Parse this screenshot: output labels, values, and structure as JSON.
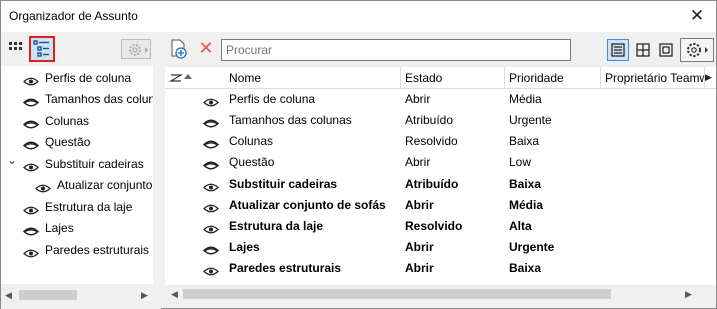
{
  "window": {
    "title": "Organizador de Assunto",
    "close_label": "✕"
  },
  "left_toolbar": {
    "grid_icon": "grid-view-icon",
    "list_icon": "hierarchy-list-icon",
    "settings_icon": "gear-icon"
  },
  "tree": [
    {
      "label": "Perfis de coluna",
      "eye": "open"
    },
    {
      "label": "Tamanhos das coluna",
      "eye": "closed"
    },
    {
      "label": "Colunas",
      "eye": "closed"
    },
    {
      "label": "Questão",
      "eye": "closed"
    },
    {
      "label": "Substituir cadeiras",
      "eye": "open",
      "expanded": true
    },
    {
      "label": "Atualizar conjunto",
      "eye": "open",
      "child": true
    },
    {
      "label": "Estrutura da laje",
      "eye": "open"
    },
    {
      "label": "Lajes",
      "eye": "closed"
    },
    {
      "label": "Paredes estruturais",
      "eye": "open"
    }
  ],
  "right_toolbar": {
    "add_icon": "add-issue-icon",
    "delete_icon": "delete-icon",
    "search_placeholder": "Procurar",
    "view_icons": [
      "list-view-icon",
      "grid-view-icon",
      "single-view-icon"
    ],
    "settings_icon": "gear-icon"
  },
  "table": {
    "columns": [
      "Nome",
      "Estado",
      "Prioridade",
      "Proprietário Teamw"
    ],
    "rows": [
      {
        "name": "Perfis de coluna",
        "state": "Abrir",
        "priority": "Média",
        "eye": "open",
        "bold": false
      },
      {
        "name": "Tamanhos das colunas",
        "state": "Atribuído",
        "priority": "Urgente",
        "eye": "closed",
        "bold": false
      },
      {
        "name": "Colunas",
        "state": "Resolvido",
        "priority": "Baixa",
        "eye": "closed",
        "bold": false
      },
      {
        "name": "Questão",
        "state": "Abrir",
        "priority": "Low",
        "eye": "closed",
        "bold": false
      },
      {
        "name": "Substituir cadeiras",
        "state": "Atribuído",
        "priority": "Baixa",
        "eye": "open",
        "bold": true
      },
      {
        "name": "Atualizar conjunto de sofás",
        "state": "Abrir",
        "priority": "Média",
        "eye": "open",
        "bold": true
      },
      {
        "name": "Estrutura da laje",
        "state": "Resolvido",
        "priority": "Alta",
        "eye": "open",
        "bold": true
      },
      {
        "name": "Lajes",
        "state": "Abrir",
        "priority": "Urgente",
        "eye": "closed",
        "bold": true
      },
      {
        "name": "Paredes estruturais",
        "state": "Abrir",
        "priority": "Baixa",
        "eye": "open",
        "bold": true
      }
    ]
  },
  "colors": {
    "highlight_border": "#e02020",
    "selected_bg": "#cfe3f7",
    "delete_red": "#e05a4f"
  }
}
